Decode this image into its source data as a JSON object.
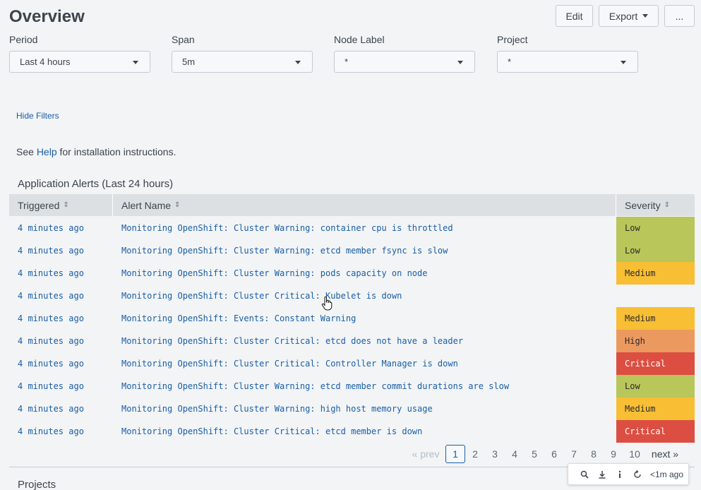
{
  "page": {
    "title": "Overview"
  },
  "toolbar_top": {
    "edit": "Edit",
    "export": "Export",
    "more": "..."
  },
  "filters": [
    {
      "label": "Period",
      "value": "Last 4 hours"
    },
    {
      "label": "Span",
      "value": "5m"
    },
    {
      "label": "Node Label",
      "value": "*"
    },
    {
      "label": "Project",
      "value": "*"
    }
  ],
  "hide_filters": "Hide Filters",
  "help": {
    "prefix": "See ",
    "link": "Help",
    "suffix": " for installation instructions."
  },
  "alerts": {
    "title": "Application Alerts (Last 24 hours)",
    "columns": [
      "Triggered",
      "Alert Name",
      "Severity"
    ],
    "rows": [
      {
        "triggered": "4 minutes ago",
        "name": "Monitoring OpenShift: Cluster Warning: container cpu is throttled",
        "severity": "Low"
      },
      {
        "triggered": "4 minutes ago",
        "name": "Monitoring OpenShift: Cluster Warning: etcd member fsync is slow",
        "severity": "Low"
      },
      {
        "triggered": "4 minutes ago",
        "name": "Monitoring OpenShift: Cluster Warning: pods capacity on node",
        "severity": "Medium"
      },
      {
        "triggered": "4 minutes ago",
        "name": "Monitoring OpenShift: Cluster Critical: Kubelet is down",
        "severity": ""
      },
      {
        "triggered": "4 minutes ago",
        "name": "Monitoring OpenShift: Events: Constant Warning",
        "severity": "Medium"
      },
      {
        "triggered": "4 minutes ago",
        "name": "Monitoring OpenShift: Cluster Critical: etcd does not have a leader",
        "severity": "High"
      },
      {
        "triggered": "4 minutes ago",
        "name": "Monitoring OpenShift: Cluster Critical: Controller Manager is down",
        "severity": "Critical"
      },
      {
        "triggered": "4 minutes ago",
        "name": "Monitoring OpenShift: Cluster Warning: etcd member commit durations are slow",
        "severity": "Low"
      },
      {
        "triggered": "4 minutes ago",
        "name": "Monitoring OpenShift: Cluster Warning: high host memory usage",
        "severity": "Medium"
      },
      {
        "triggered": "4 minutes ago",
        "name": "Monitoring OpenShift: Cluster Critical: etcd member is down",
        "severity": "Critical"
      }
    ]
  },
  "severity_colors": {
    "Low": "#b8c65a",
    "Medium": "#f8be34",
    "High": "#ec9960",
    "Critical": "#dc4e41"
  },
  "pagination": {
    "prev": "« prev",
    "pages": [
      "1",
      "2",
      "3",
      "4",
      "5",
      "6",
      "7",
      "8",
      "9",
      "10"
    ],
    "active": "1",
    "next": "next »"
  },
  "panel_toolbar": {
    "icons": [
      "search-icon",
      "download-icon",
      "info-icon",
      "refresh-icon"
    ],
    "time": "<1m ago"
  },
  "projects_title": "Projects"
}
